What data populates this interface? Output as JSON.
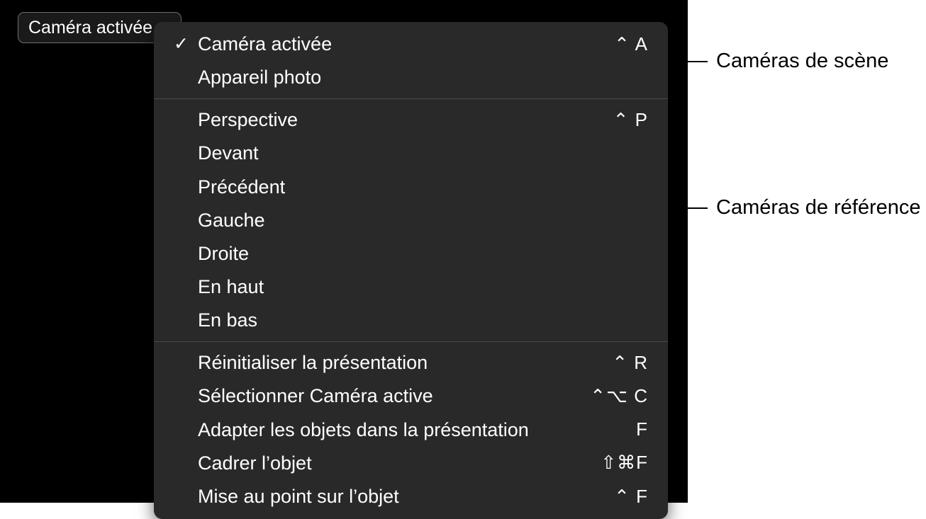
{
  "dropdown": {
    "selected_label": "Caméra activée"
  },
  "menu": {
    "section1": {
      "items": [
        {
          "label": "Caméra activée",
          "shortcut": "⌃ A",
          "checked": true
        },
        {
          "label": "Appareil photo",
          "shortcut": "",
          "checked": false
        }
      ]
    },
    "section2": {
      "items": [
        {
          "label": "Perspective",
          "shortcut": "⌃ P",
          "checked": false
        },
        {
          "label": "Devant",
          "shortcut": "",
          "checked": false
        },
        {
          "label": "Précédent",
          "shortcut": "",
          "checked": false
        },
        {
          "label": "Gauche",
          "shortcut": "",
          "checked": false
        },
        {
          "label": "Droite",
          "shortcut": "",
          "checked": false
        },
        {
          "label": "En haut",
          "shortcut": "",
          "checked": false
        },
        {
          "label": "En bas",
          "shortcut": "",
          "checked": false
        }
      ]
    },
    "section3": {
      "items": [
        {
          "label": "Réinitialiser la présentation",
          "shortcut": "⌃ R",
          "checked": false
        },
        {
          "label": "Sélectionner Caméra active",
          "shortcut": "⌃⌥ C",
          "checked": false
        },
        {
          "label": "Adapter les objets dans la présentation",
          "shortcut": "F",
          "checked": false
        },
        {
          "label": "Cadrer l’objet",
          "shortcut": "⇧⌘F",
          "checked": false
        },
        {
          "label": "Mise au point sur l’objet",
          "shortcut": "⌃ F",
          "checked": false
        }
      ]
    }
  },
  "callouts": {
    "scene": "Caméras de scène",
    "reference": "Caméras de référence"
  }
}
